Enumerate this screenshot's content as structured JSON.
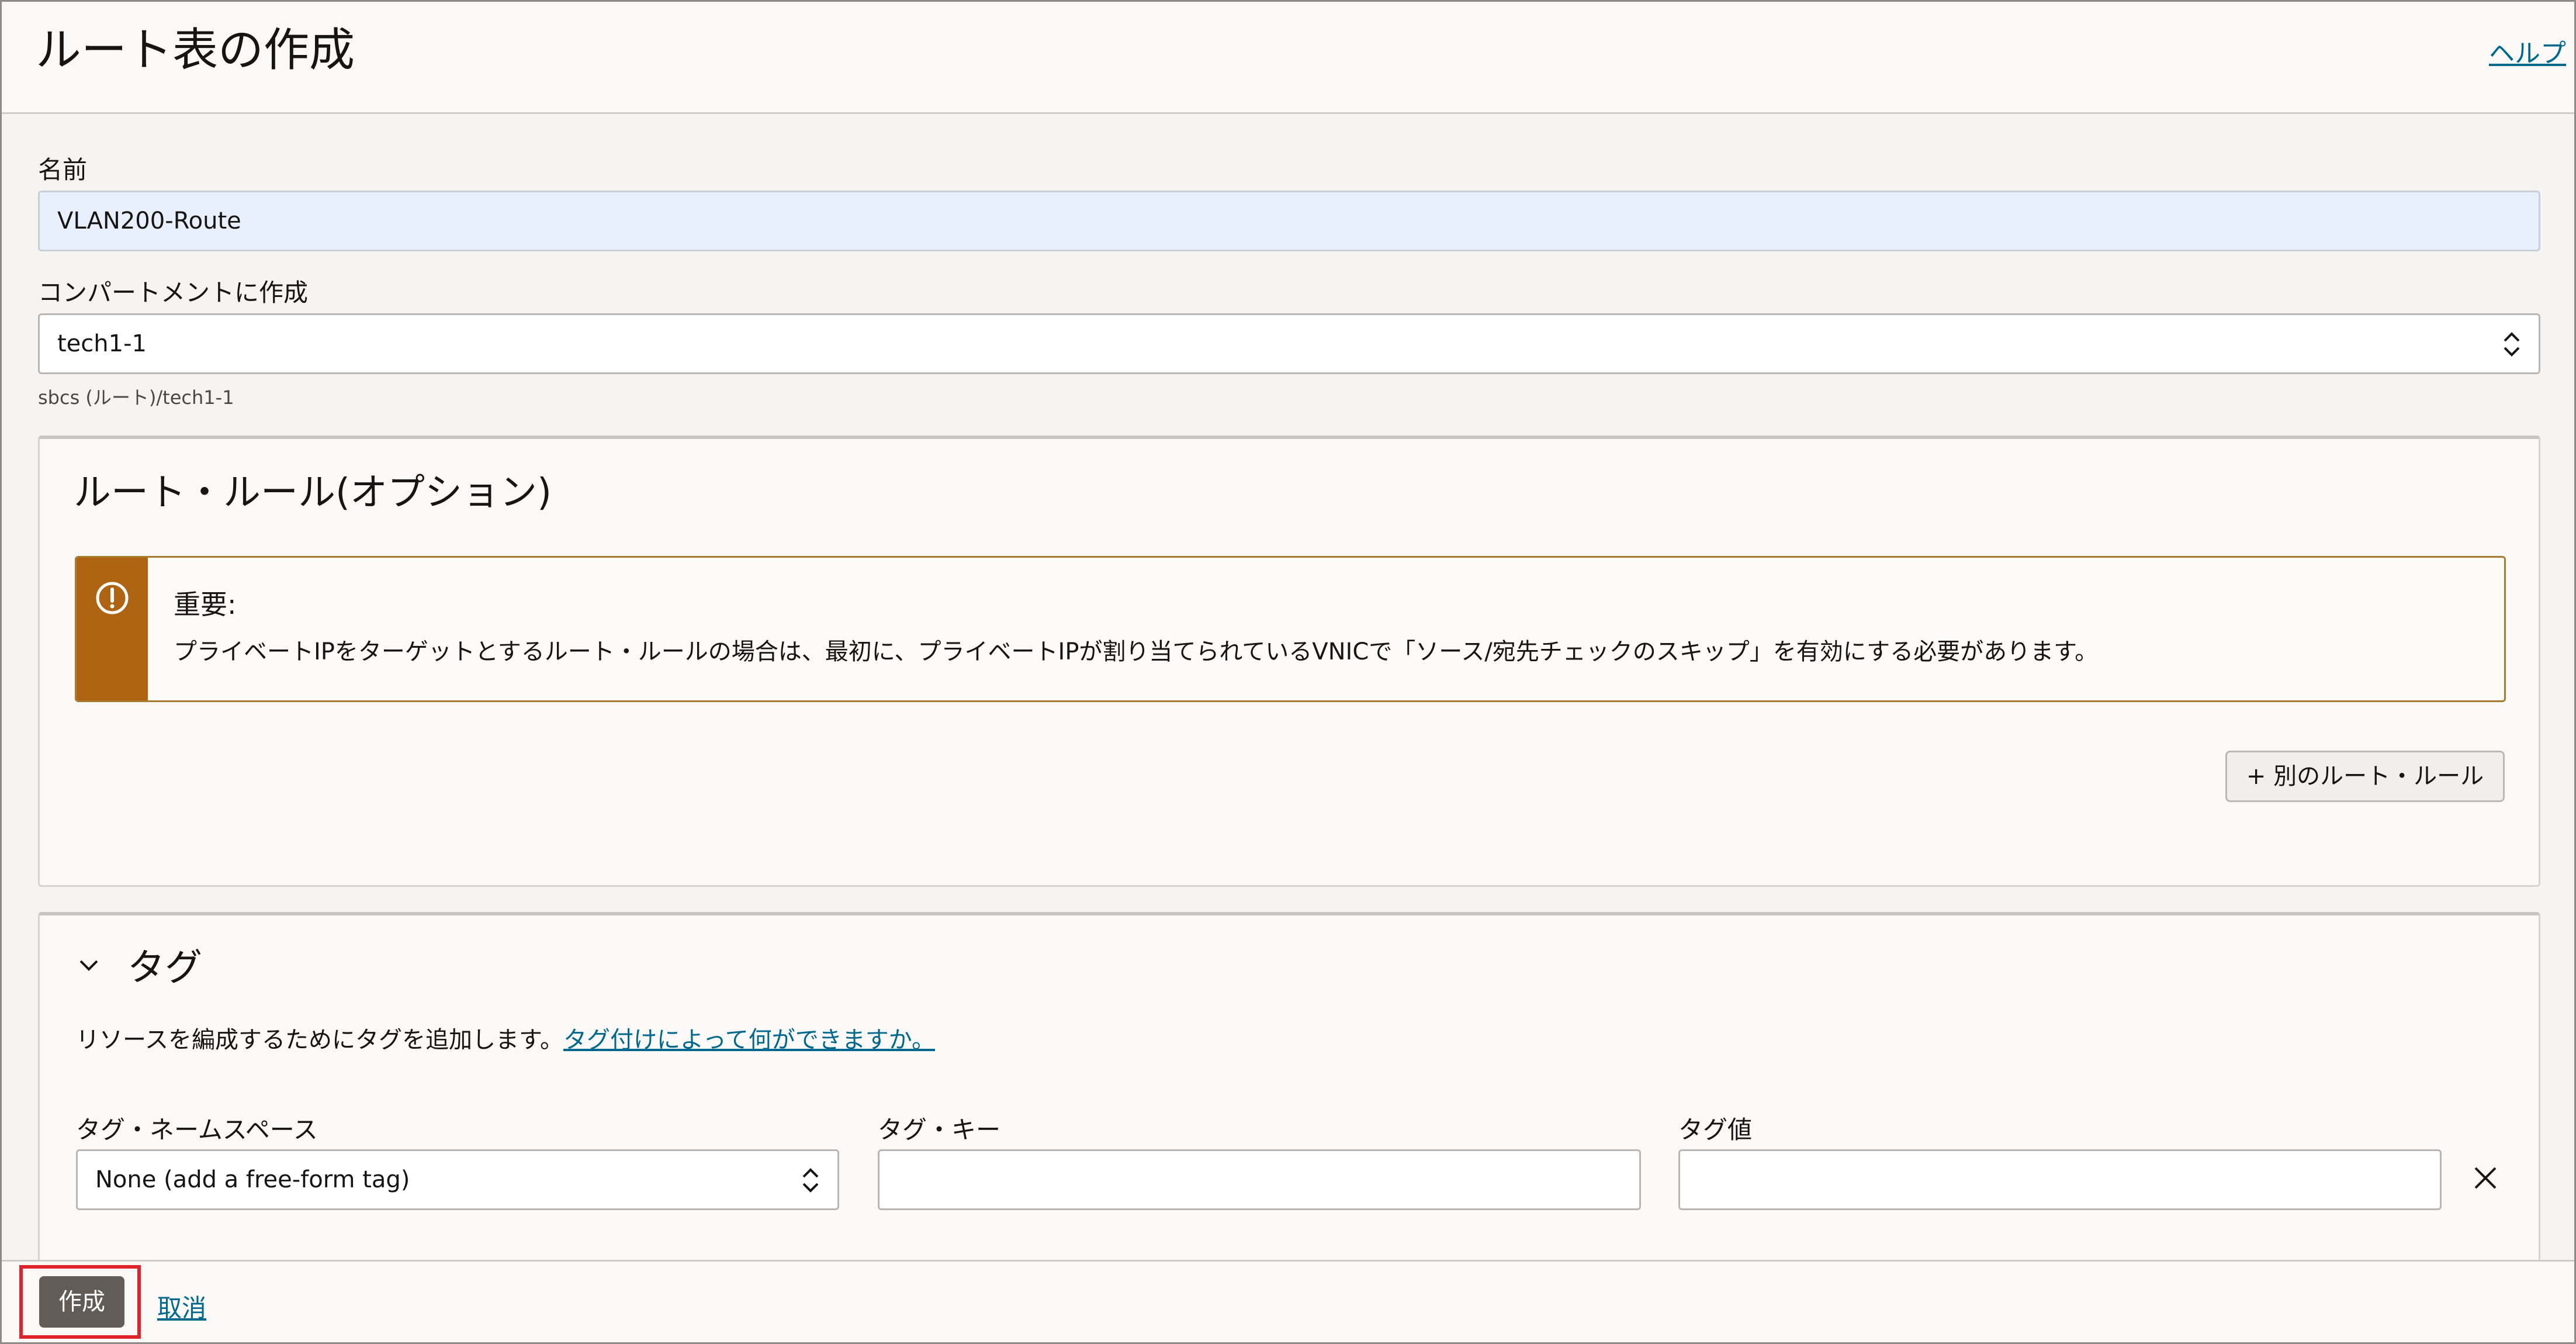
{
  "header": {
    "title": "ルート表の作成",
    "help_link": "ヘルプ"
  },
  "form": {
    "name_label": "名前",
    "name_value": "VLAN200-Route",
    "compartment_label": "コンパートメントに作成",
    "compartment_value": "tech1-1",
    "compartment_path": "sbcs (ルート)/tech1-1"
  },
  "route_rules": {
    "title": "ルート・ルール(オプション)",
    "alert_title": "重要:",
    "alert_text": "プライベートIPをターゲットとするルート・ルールの場合は、最初に、プライベートIPが割り当てられているVNICで「ソース/宛先チェックのスキップ」を有効にする必要があります。",
    "add_rule_button": "+ 別のルート・ルール"
  },
  "tags": {
    "title": "タグ",
    "description": "リソースを編成するためにタグを追加します。",
    "help_link": "タグ付けによって何ができますか。",
    "namespace_label": "タグ・ネームスペース",
    "namespace_value": "None (add a free-form tag)",
    "key_label": "タグ・キー",
    "key_value": "",
    "value_label": "タグ値",
    "value_value": ""
  },
  "footer": {
    "create_button": "作成",
    "cancel_link": "取消"
  },
  "colors": {
    "primary_button": "#635b55",
    "link": "#00688c",
    "warning_bar": "#ae6412",
    "highlight": "#e0232a",
    "autofill": "#e8f0fe"
  },
  "icons": [
    "alert-icon",
    "select-chevron-icon",
    "collapse-chevron-icon",
    "close-icon"
  ]
}
